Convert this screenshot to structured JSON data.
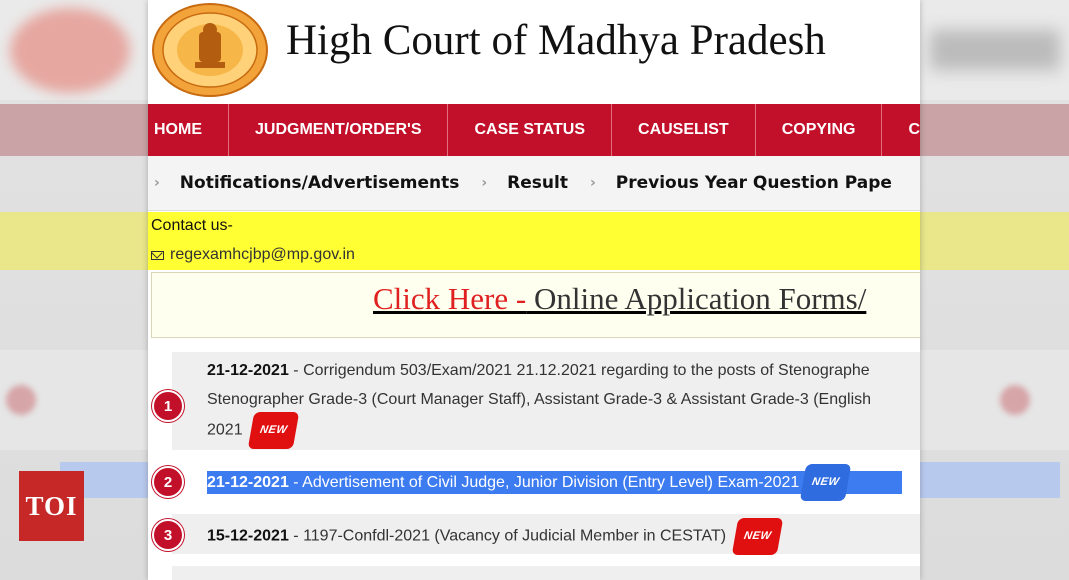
{
  "site": {
    "title": "High Court of Madhya Pradesh"
  },
  "nav": {
    "items": [
      "HOME",
      "JUDGMENT/ORDER'S",
      "CASE STATUS",
      "CAUSELIST",
      "COPYING",
      "CAVEAT"
    ]
  },
  "subnav": {
    "items": [
      "Notifications/Advertisements",
      "Result",
      "Previous Year Question Pape"
    ]
  },
  "contact": {
    "title": "Contact us-",
    "email": "regexamhcjbp@mp.gov.in"
  },
  "apply": {
    "click_text": "Click Here -",
    "rest_text": " Online Application Forms/"
  },
  "notices": [
    {
      "number": "1",
      "date": "21-12-2021",
      "line1": " - Corrigendum 503/Exam/2021 21.12.2021 regarding to the posts of Stenographe",
      "line2": "Stenographer Grade-3 (Court Manager Staff), Assistant Grade-3 & Assistant Grade-3 (English",
      "line3": "2021",
      "badge": "NEW"
    },
    {
      "number": "2",
      "date": "21-12-2021",
      "text": " - Advertisement of Civil Judge, Junior Division (Entry Level) Exam-2021",
      "badge": "NEW"
    },
    {
      "number": "3",
      "date": "15-12-2021",
      "text": " - 1197-Confdl-2021 (Vacancy of Judicial Member in CESTAT)",
      "badge": "NEW"
    }
  ],
  "watermark": {
    "label": "TOI"
  },
  "colors": {
    "nav_bg": "#c2102a",
    "contact_bg": "#ffff33",
    "highlight": "#3d7cf0"
  }
}
